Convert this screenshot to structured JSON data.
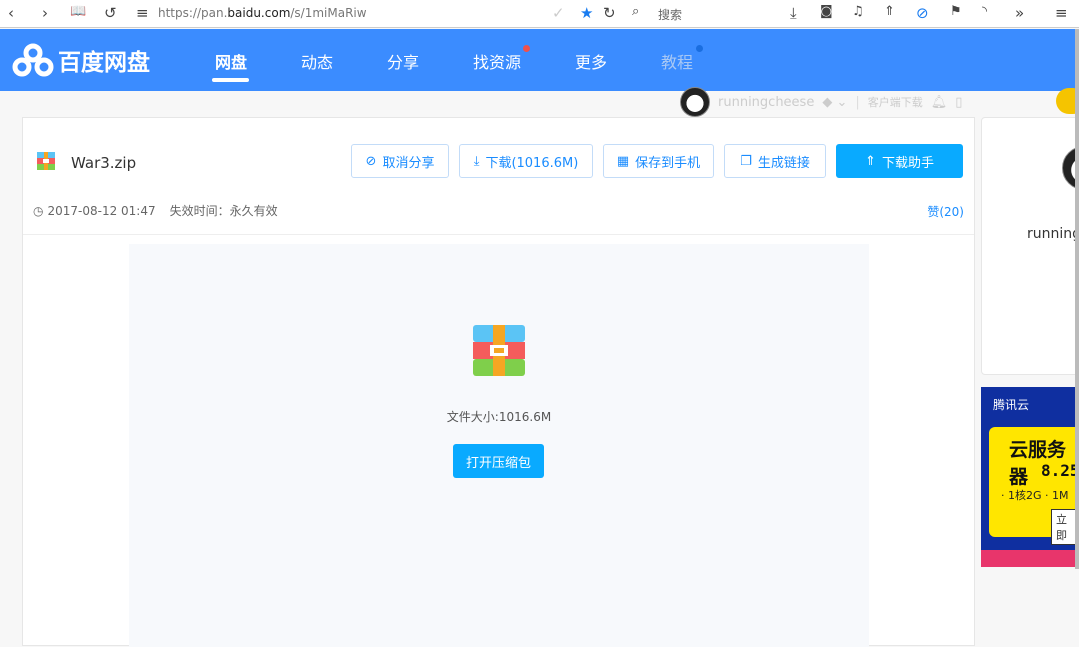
{
  "browser": {
    "url_prefix": "https://pan.",
    "url_domain": "baidu.com",
    "url_path": "/s/1miMaRiw",
    "search_placeholder": "搜索"
  },
  "nav": {
    "logo": "百度网盘",
    "items": [
      "网盘",
      "动态",
      "分享",
      "找资源",
      "更多",
      "教程"
    ]
  },
  "user": {
    "name": "runningcheese",
    "client_download": "客户端下载"
  },
  "file": {
    "name": "War3.zip",
    "date": "2017-08-12 01:47",
    "expire": "失效时间：永久有效",
    "likes": "赞(20)",
    "size": "文件大小:1016.6M",
    "open": "打开压缩包"
  },
  "actions": {
    "cancel_share": "取消分享",
    "download": "下载(1016.6M)",
    "save_phone": "保存到手机",
    "gen_link": "生成链接",
    "helper": "下载助手"
  },
  "sidebar": {
    "name": "running"
  },
  "ad": {
    "brand": "腾讯云",
    "title": "云服务器",
    "price": "8.25",
    "spec": "· 1核2G · 1M",
    "cta": "立即"
  },
  "colors": {
    "nav": "#3b8cff",
    "primary": "#09aaff"
  }
}
